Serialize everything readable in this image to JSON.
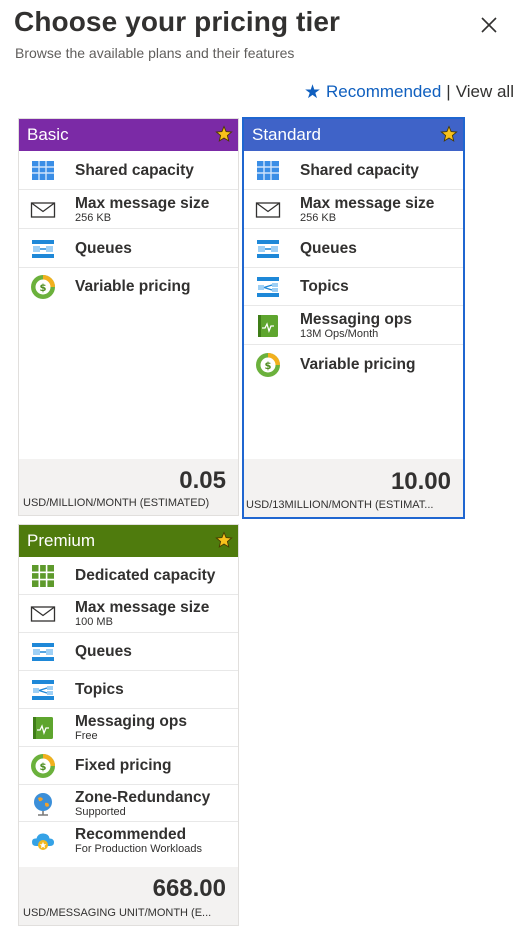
{
  "header": {
    "title": "Choose your pricing tier",
    "subtitle": "Browse the available plans and their features"
  },
  "filter": {
    "recommended_label": "Recommended",
    "separator": "|",
    "view_all_label": "View all"
  },
  "tiers": [
    {
      "name": "Basic",
      "color": "#7b2aa6",
      "selected": false,
      "features": [
        {
          "icon": "shared-capacity-icon",
          "name": "Shared capacity",
          "sub": ""
        },
        {
          "icon": "envelope-icon",
          "name": "Max message size",
          "sub": "256 KB"
        },
        {
          "icon": "queue-icon",
          "name": "Queues",
          "sub": ""
        },
        {
          "icon": "pricing-icon",
          "name": "Variable pricing",
          "sub": ""
        }
      ],
      "price": "0.05",
      "unit": "USD/MILLION/MONTH (ESTIMATED)"
    },
    {
      "name": "Standard",
      "color": "#3f63c8",
      "selected": true,
      "features": [
        {
          "icon": "shared-capacity-icon",
          "name": "Shared capacity",
          "sub": ""
        },
        {
          "icon": "envelope-icon",
          "name": "Max message size",
          "sub": "256 KB"
        },
        {
          "icon": "queue-icon",
          "name": "Queues",
          "sub": ""
        },
        {
          "icon": "topics-icon",
          "name": "Topics",
          "sub": ""
        },
        {
          "icon": "messaging-ops-icon",
          "name": "Messaging ops",
          "sub": "13M Ops/Month"
        },
        {
          "icon": "pricing-icon",
          "name": "Variable pricing",
          "sub": ""
        }
      ],
      "price": "10.00",
      "unit": "USD/13MILLION/MONTH (ESTIMAT..."
    },
    {
      "name": "Premium",
      "color": "#4f7b0d",
      "selected": false,
      "features": [
        {
          "icon": "dedicated-capacity-icon",
          "name": "Dedicated capacity",
          "sub": ""
        },
        {
          "icon": "envelope-icon",
          "name": "Max message size",
          "sub": "100 MB"
        },
        {
          "icon": "queue-icon",
          "name": "Queues",
          "sub": ""
        },
        {
          "icon": "topics-icon",
          "name": "Topics",
          "sub": ""
        },
        {
          "icon": "messaging-ops-icon",
          "name": "Messaging ops",
          "sub": "Free"
        },
        {
          "icon": "pricing-icon",
          "name": "Fixed pricing",
          "sub": ""
        },
        {
          "icon": "globe-icon",
          "name": "Zone-Redundancy",
          "sub": "Supported"
        },
        {
          "icon": "cloud-star-icon",
          "name": "Recommended",
          "sub": "For Production Workloads"
        }
      ],
      "price": "668.00",
      "unit": "USD/MESSAGING UNIT/MONTH (E..."
    }
  ]
}
